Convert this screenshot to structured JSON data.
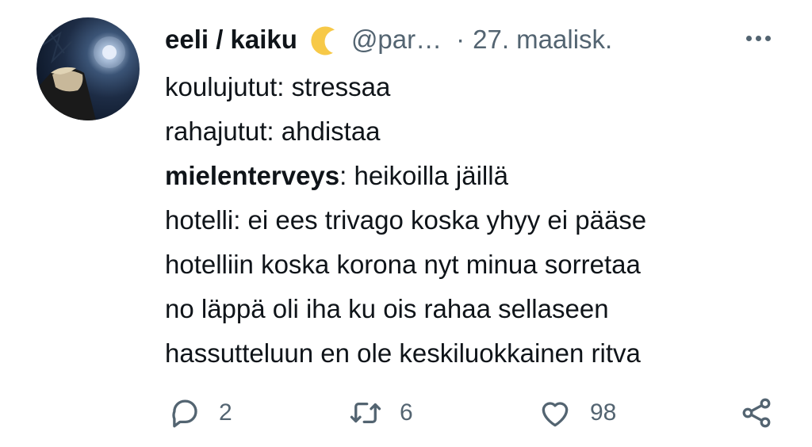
{
  "tweet": {
    "display_name": "eeli / kaiku",
    "name_emoji_icon": "crescent-moon-icon",
    "handle": "@par…",
    "separator": "·",
    "date": "27. maalisk.",
    "more_icon": "more-horizontal-icon",
    "lines": {
      "l1": "koulujutut: stressaa",
      "l2": "rahajutut: ahdistaa",
      "l3_bold": "mielenterveys",
      "l3_rest": ": heikoilla jäillä",
      "l4": "hotelli: ei ees trivago koska yhyy ei pääse",
      "l5": "hotelliin koska korona nyt minua sorretaa",
      "l6": "no läppä oli iha ku ois rahaa sellaseen",
      "l7": "hassutteluun en ole keskiluokkainen ritva"
    },
    "actions": {
      "reply": {
        "icon": "reply-icon",
        "count": "2"
      },
      "retweet": {
        "icon": "retweet-icon",
        "count": "6"
      },
      "like": {
        "icon": "heart-icon",
        "count": "98"
      },
      "share": {
        "icon": "share-icon"
      }
    }
  },
  "colors": {
    "text_primary": "#0f1419",
    "text_secondary": "#536471",
    "moon": "#f7c948"
  }
}
